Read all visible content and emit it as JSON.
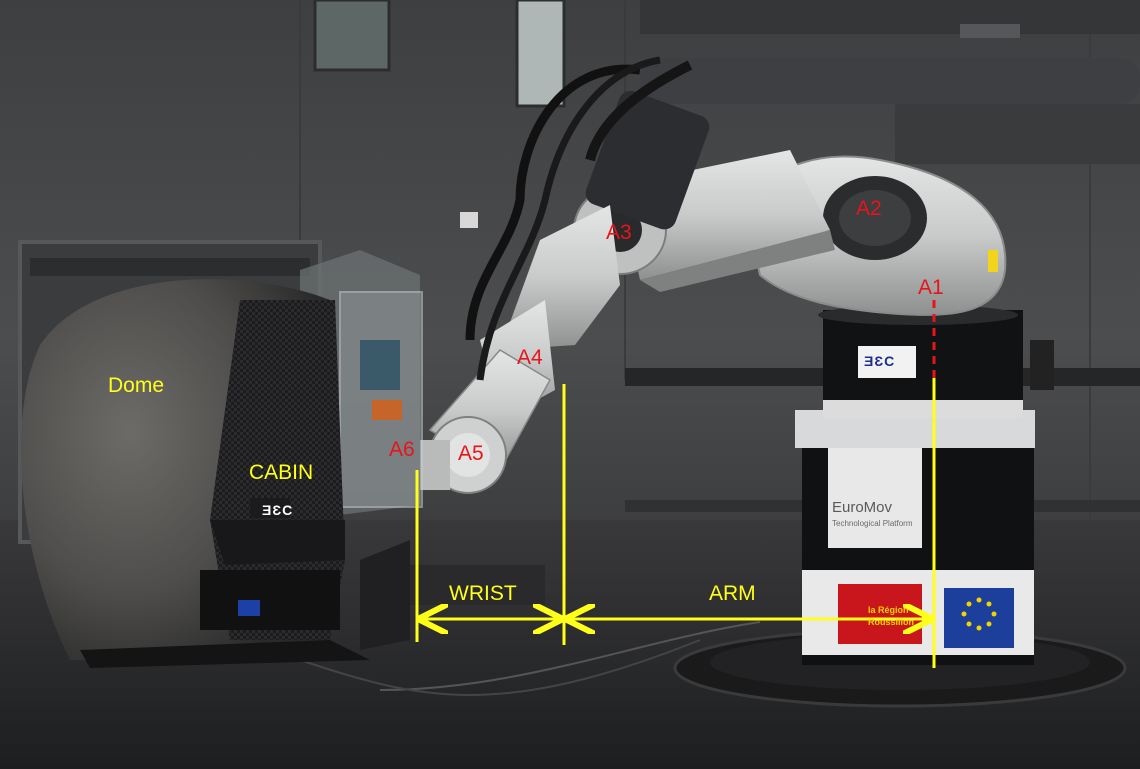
{
  "labels": {
    "dome": "Dome",
    "cabin": "CABIN",
    "wrist": "WRIST",
    "arm": "ARM",
    "axes": [
      "A1",
      "A2",
      "A3",
      "A4",
      "A5",
      "A6"
    ]
  },
  "logos": {
    "cabin_logo": "ƎƐC",
    "base_logo": "ƎƐC",
    "euromov_title": "EuroMov",
    "euromov_subtitle": "Technological Platform",
    "region_sticker": "la Région Roussillon"
  },
  "colors": {
    "annotation_yellow": "#ffff1a",
    "axis_red": "#e8141a",
    "wall": "#4a4b4d",
    "floor": "#2b2c2e",
    "robot_white": "#cfd1d1",
    "base_black": "#111214",
    "eu_blue": "#1b3f9a"
  }
}
